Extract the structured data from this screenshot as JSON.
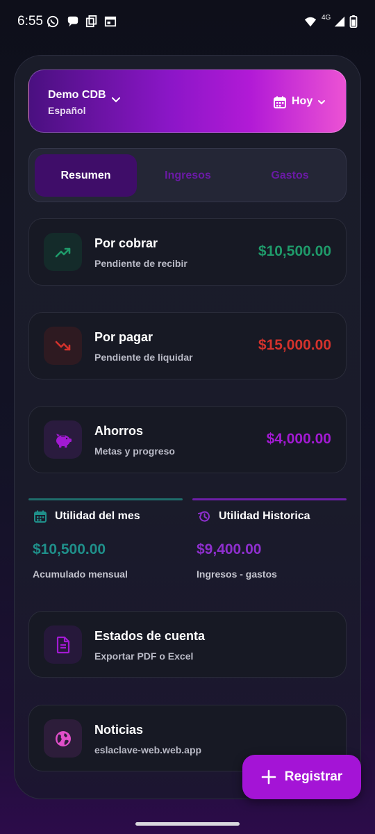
{
  "status_bar": {
    "time": "6:55",
    "network_label": "4G",
    "left_icons": [
      "whatsapp-icon",
      "chat-bubble-icon",
      "copy-icon",
      "calendar-window-icon"
    ],
    "right_icons": [
      "wifi-icon",
      "signal-icon",
      "battery-icon"
    ]
  },
  "header": {
    "org_name": "Demo CDB",
    "org_language": "Español",
    "date_filter": "Hoy"
  },
  "tabs": [
    {
      "label": "Resumen",
      "active": true
    },
    {
      "label": "Ingresos",
      "active": false
    },
    {
      "label": "Gastos",
      "active": false
    }
  ],
  "cards": {
    "receivable": {
      "title": "Por cobrar",
      "subtitle": "Pendiente de recibir",
      "amount": "$10,500.00",
      "icon": "trending-up-icon",
      "color": "#1f9a6a"
    },
    "payable": {
      "title": "Por pagar",
      "subtitle": "Pendiente de liquidar",
      "amount": "$15,000.00",
      "icon": "trending-down-icon",
      "color": "#d4322c"
    },
    "savings": {
      "title": "Ahorros",
      "subtitle": "Metas y progreso",
      "amount": "$4,000.00",
      "icon": "piggy-bank-icon",
      "color": "#a21ad2"
    }
  },
  "stats": {
    "monthly": {
      "title": "Utilidad del mes",
      "amount": "$10,500.00",
      "subtitle": "Acumulado mensual",
      "icon": "calendar-icon",
      "color": "#1f8f8a"
    },
    "historic": {
      "title": "Utilidad Historica",
      "amount": "$9,400.00",
      "subtitle": "Ingresos - gastos",
      "icon": "history-icon",
      "color": "#8e2fce"
    }
  },
  "links": {
    "statements": {
      "title": "Estados de cuenta",
      "subtitle": "Exportar PDF o Excel",
      "icon": "document-icon"
    },
    "news": {
      "title": "Noticias",
      "subtitle": "eslaclave-web.web.app",
      "icon": "globe-icon"
    }
  },
  "fab": {
    "label": "Registrar",
    "icon": "plus-icon"
  }
}
